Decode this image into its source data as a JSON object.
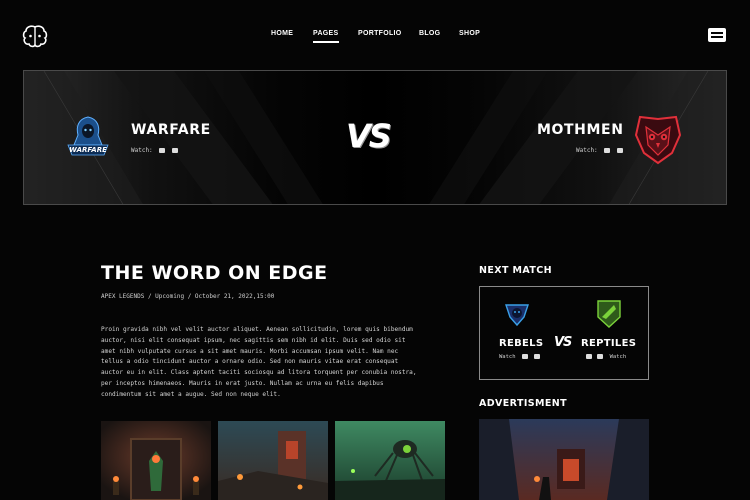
{
  "nav": {
    "items": [
      "HOME",
      "PAGES",
      "PORTFOLIO",
      "BLOG",
      "SHOP"
    ],
    "active": "PAGES"
  },
  "banner": {
    "team_left": {
      "name": "WARFARE",
      "watch_label": "Watch:",
      "logo_text": "WARFARE"
    },
    "vs": "VS",
    "team_right": {
      "name": "MOTHMEN",
      "watch_label": "Watch:"
    }
  },
  "article": {
    "title": "THE WORD ON EDGE",
    "meta": "APEX LEGENDS / Upcoming / October 21, 2022,15:00",
    "body": "Proin gravida nibh vel velit auctor aliquet. Aenean sollicitudin, lorem quis bibendum auctor, nisi elit consequat ipsum, nec sagittis sem nibh id elit. Duis sed odio sit amet nibh vulputate cursus a sit amet mauris. Morbi accumsan ipsum velit. Nam nec tellus a odio tincidunt auctor a ornare odio. Sed non mauris vitae erat consequat auctor eu in elit. Class aptent taciti sociosqu ad litora torquent per conubia nostra, per inceptos himenaeos. Mauris in erat justo. Nullam ac urna eu felis dapibus condimentum sit amet a augue. Sed non neque elit."
  },
  "sidebar": {
    "next_match_heading": "NEXT MATCH",
    "next_match": {
      "team_left": {
        "name": "REBELS",
        "watch_label": "Watch"
      },
      "vs": "VS",
      "team_right": {
        "name": "REPTILES",
        "watch_label": "Watch"
      }
    },
    "ad_heading": "ADVERTISMENT"
  },
  "colors": {
    "background": "#050505",
    "accent_red": "#e0303a",
    "accent_blue": "#3aa0e8",
    "accent_green": "#7bd23a"
  }
}
